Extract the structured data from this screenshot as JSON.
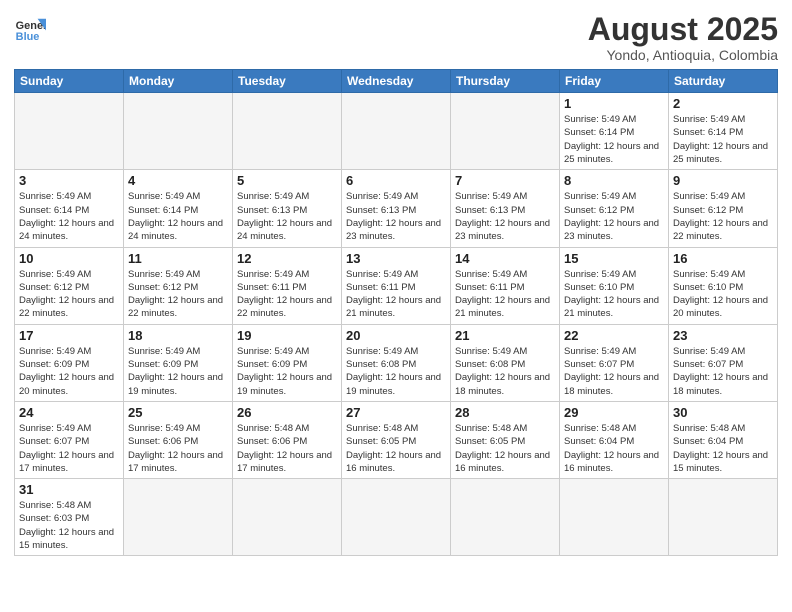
{
  "header": {
    "logo_general": "General",
    "logo_blue": "Blue",
    "title": "August 2025",
    "subtitle": "Yondo, Antioquia, Colombia"
  },
  "weekdays": [
    "Sunday",
    "Monday",
    "Tuesday",
    "Wednesday",
    "Thursday",
    "Friday",
    "Saturday"
  ],
  "weeks": [
    [
      {
        "day": "",
        "info": ""
      },
      {
        "day": "",
        "info": ""
      },
      {
        "day": "",
        "info": ""
      },
      {
        "day": "",
        "info": ""
      },
      {
        "day": "",
        "info": ""
      },
      {
        "day": "1",
        "info": "Sunrise: 5:49 AM\nSunset: 6:14 PM\nDaylight: 12 hours\nand 25 minutes."
      },
      {
        "day": "2",
        "info": "Sunrise: 5:49 AM\nSunset: 6:14 PM\nDaylight: 12 hours\nand 25 minutes."
      }
    ],
    [
      {
        "day": "3",
        "info": "Sunrise: 5:49 AM\nSunset: 6:14 PM\nDaylight: 12 hours\nand 24 minutes."
      },
      {
        "day": "4",
        "info": "Sunrise: 5:49 AM\nSunset: 6:14 PM\nDaylight: 12 hours\nand 24 minutes."
      },
      {
        "day": "5",
        "info": "Sunrise: 5:49 AM\nSunset: 6:13 PM\nDaylight: 12 hours\nand 24 minutes."
      },
      {
        "day": "6",
        "info": "Sunrise: 5:49 AM\nSunset: 6:13 PM\nDaylight: 12 hours\nand 23 minutes."
      },
      {
        "day": "7",
        "info": "Sunrise: 5:49 AM\nSunset: 6:13 PM\nDaylight: 12 hours\nand 23 minutes."
      },
      {
        "day": "8",
        "info": "Sunrise: 5:49 AM\nSunset: 6:12 PM\nDaylight: 12 hours\nand 23 minutes."
      },
      {
        "day": "9",
        "info": "Sunrise: 5:49 AM\nSunset: 6:12 PM\nDaylight: 12 hours\nand 22 minutes."
      }
    ],
    [
      {
        "day": "10",
        "info": "Sunrise: 5:49 AM\nSunset: 6:12 PM\nDaylight: 12 hours\nand 22 minutes."
      },
      {
        "day": "11",
        "info": "Sunrise: 5:49 AM\nSunset: 6:12 PM\nDaylight: 12 hours\nand 22 minutes."
      },
      {
        "day": "12",
        "info": "Sunrise: 5:49 AM\nSunset: 6:11 PM\nDaylight: 12 hours\nand 22 minutes."
      },
      {
        "day": "13",
        "info": "Sunrise: 5:49 AM\nSunset: 6:11 PM\nDaylight: 12 hours\nand 21 minutes."
      },
      {
        "day": "14",
        "info": "Sunrise: 5:49 AM\nSunset: 6:11 PM\nDaylight: 12 hours\nand 21 minutes."
      },
      {
        "day": "15",
        "info": "Sunrise: 5:49 AM\nSunset: 6:10 PM\nDaylight: 12 hours\nand 21 minutes."
      },
      {
        "day": "16",
        "info": "Sunrise: 5:49 AM\nSunset: 6:10 PM\nDaylight: 12 hours\nand 20 minutes."
      }
    ],
    [
      {
        "day": "17",
        "info": "Sunrise: 5:49 AM\nSunset: 6:09 PM\nDaylight: 12 hours\nand 20 minutes."
      },
      {
        "day": "18",
        "info": "Sunrise: 5:49 AM\nSunset: 6:09 PM\nDaylight: 12 hours\nand 19 minutes."
      },
      {
        "day": "19",
        "info": "Sunrise: 5:49 AM\nSunset: 6:09 PM\nDaylight: 12 hours\nand 19 minutes."
      },
      {
        "day": "20",
        "info": "Sunrise: 5:49 AM\nSunset: 6:08 PM\nDaylight: 12 hours\nand 19 minutes."
      },
      {
        "day": "21",
        "info": "Sunrise: 5:49 AM\nSunset: 6:08 PM\nDaylight: 12 hours\nand 18 minutes."
      },
      {
        "day": "22",
        "info": "Sunrise: 5:49 AM\nSunset: 6:07 PM\nDaylight: 12 hours\nand 18 minutes."
      },
      {
        "day": "23",
        "info": "Sunrise: 5:49 AM\nSunset: 6:07 PM\nDaylight: 12 hours\nand 18 minutes."
      }
    ],
    [
      {
        "day": "24",
        "info": "Sunrise: 5:49 AM\nSunset: 6:07 PM\nDaylight: 12 hours\nand 17 minutes."
      },
      {
        "day": "25",
        "info": "Sunrise: 5:49 AM\nSunset: 6:06 PM\nDaylight: 12 hours\nand 17 minutes."
      },
      {
        "day": "26",
        "info": "Sunrise: 5:48 AM\nSunset: 6:06 PM\nDaylight: 12 hours\nand 17 minutes."
      },
      {
        "day": "27",
        "info": "Sunrise: 5:48 AM\nSunset: 6:05 PM\nDaylight: 12 hours\nand 16 minutes."
      },
      {
        "day": "28",
        "info": "Sunrise: 5:48 AM\nSunset: 6:05 PM\nDaylight: 12 hours\nand 16 minutes."
      },
      {
        "day": "29",
        "info": "Sunrise: 5:48 AM\nSunset: 6:04 PM\nDaylight: 12 hours\nand 16 minutes."
      },
      {
        "day": "30",
        "info": "Sunrise: 5:48 AM\nSunset: 6:04 PM\nDaylight: 12 hours\nand 15 minutes."
      }
    ],
    [
      {
        "day": "31",
        "info": "Sunrise: 5:48 AM\nSunset: 6:03 PM\nDaylight: 12 hours\nand 15 minutes."
      },
      {
        "day": "",
        "info": ""
      },
      {
        "day": "",
        "info": ""
      },
      {
        "day": "",
        "info": ""
      },
      {
        "day": "",
        "info": ""
      },
      {
        "day": "",
        "info": ""
      },
      {
        "day": "",
        "info": ""
      }
    ]
  ]
}
